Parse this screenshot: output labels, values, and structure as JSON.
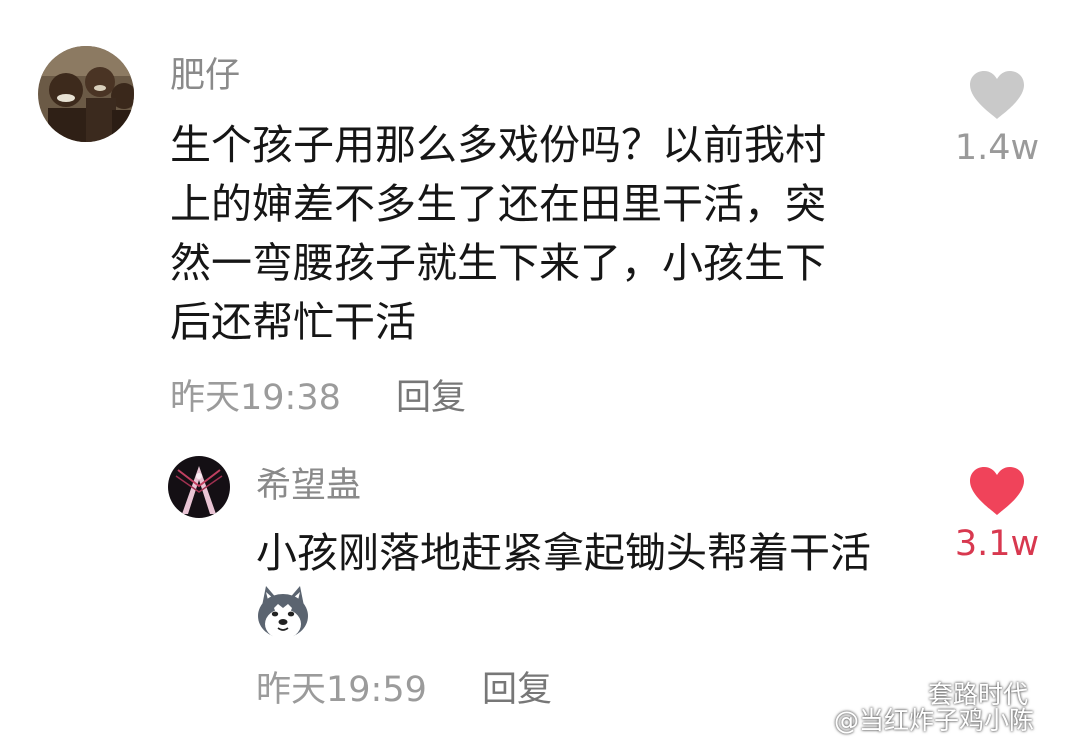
{
  "comment": {
    "username": "肥仔",
    "text_lines": [
      "生个孩子用那么多戏份吗？以前我村",
      "上的婶差不多生了还在田里干活，突",
      "然一弯腰孩子就生下来了，小孩生下",
      "后还帮忙干活"
    ],
    "timestamp": "昨天19:38",
    "reply_label": "回复",
    "like_count": "1.4w",
    "liked": false,
    "like_color": "#c9c9c9"
  },
  "reply": {
    "username": "希望蛊",
    "text": "小孩刚落地赶紧拿起锄头帮着干活",
    "sticker": "husky-dog-emoji",
    "timestamp": "昨天19:59",
    "reply_label": "回复",
    "like_count": "3.1w",
    "liked": true,
    "like_color": "#f0435a"
  },
  "watermarks": {
    "wechat_source": "套路时代",
    "weibo_source": "@当红炸子鸡小陈"
  }
}
